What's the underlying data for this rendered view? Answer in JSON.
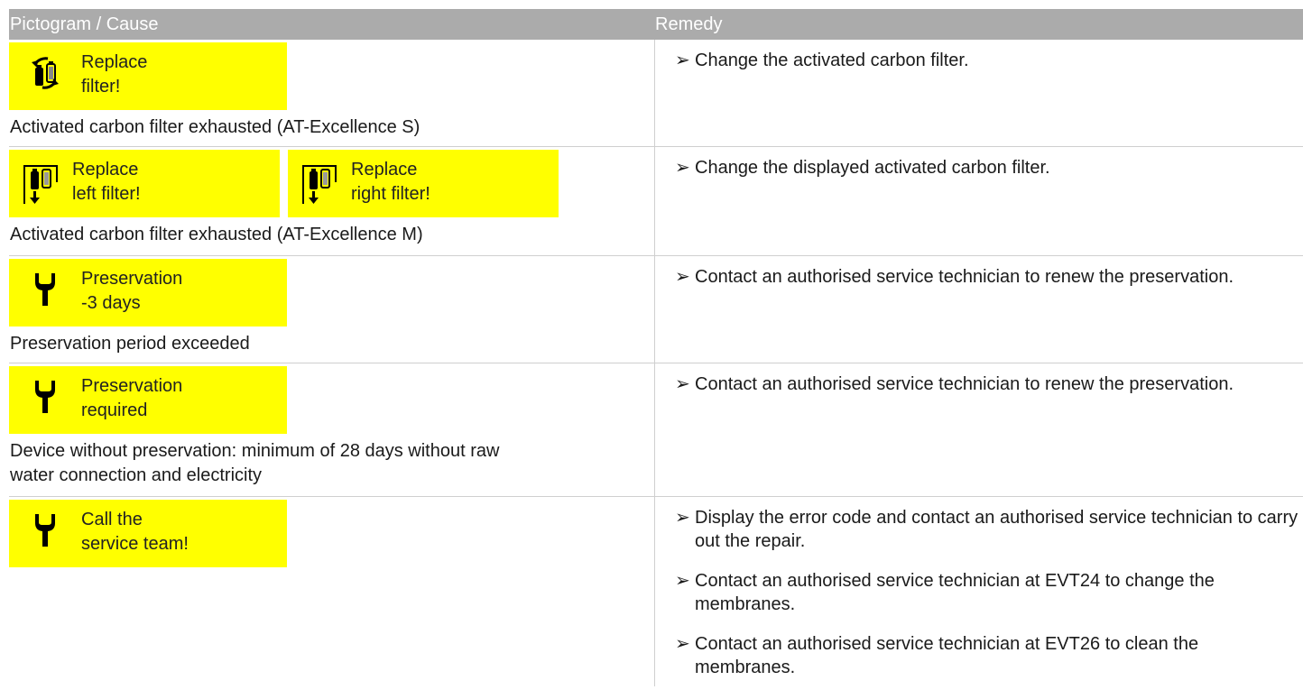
{
  "header": {
    "col1": "Pictogram / Cause",
    "col2": "Remedy"
  },
  "colors": {
    "header_bg": "#ababab",
    "display_bg": "#ffff00",
    "divider": "#cfcfcf"
  },
  "bullet": "➢",
  "rows": [
    {
      "pictograms": [
        {
          "icon": "filter-swap-icon",
          "line1": "Replace",
          "line2": "filter!"
        }
      ],
      "cause": "Activated carbon filter exhausted (AT-Excellence S)",
      "remedies": [
        "Change the activated carbon filter."
      ]
    },
    {
      "pictograms": [
        {
          "icon": "left-filter-icon",
          "line1": "Replace",
          "line2": "left filter!"
        },
        {
          "icon": "right-filter-icon",
          "line1": "Replace",
          "line2": "right filter!"
        }
      ],
      "cause": "Activated carbon filter exhausted (AT-Excellence M)",
      "remedies": [
        "Change the displayed activated carbon filter."
      ]
    },
    {
      "pictograms": [
        {
          "icon": "wrench-icon",
          "line1": "Preservation",
          "line2": "-3 days"
        }
      ],
      "cause": "Preservation period exceeded",
      "remedies": [
        "Contact an authorised service technician to renew the preservation."
      ]
    },
    {
      "pictograms": [
        {
          "icon": "wrench-icon",
          "line1": "Preservation",
          "line2": "required"
        }
      ],
      "cause": "Device without preservation: minimum of 28 days without raw water connection and electricity",
      "remedies": [
        "Contact an authorised service technician to renew the preservation."
      ]
    },
    {
      "pictograms": [
        {
          "icon": "wrench-icon",
          "line1": "Call the",
          "line2": "service team!"
        }
      ],
      "cause": "",
      "remedies": [
        "Display the error code and contact an authorised service technician to carry out the repair.",
        "Contact an authorised service technician at EVT24 to change the membranes.",
        "Contact an authorised service technician at EVT26 to clean the membranes."
      ]
    }
  ]
}
